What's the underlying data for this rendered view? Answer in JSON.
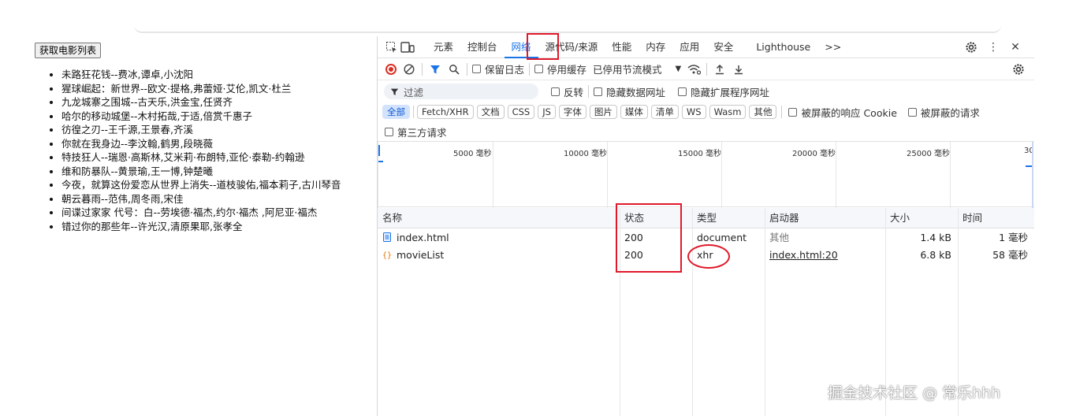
{
  "page": {
    "button_label": "获取电影列表",
    "movies": [
      "未路狂花钱--费冰,谭卓,小沈阳",
      "猩球崛起：新世界--欧文·提格,弗蕾娅·艾伦,凯文·杜兰",
      "九龙城寨之围城--古天乐,洪金宝,任贤齐",
      "哈尔的移动城堡--木村拓哉,于适,倍赏千惠子",
      "彷徨之刃--王千源,王景春,齐溪",
      "你就在我身边--李汶翰,鹤男,段晓薇",
      "特技狂人--瑞恩·高斯林,艾米莉·布朗特,亚伦·泰勒-约翰逊",
      "维和防暴队--黄景瑜,王一博,钟楚曦",
      "今夜，就算这份爱恋从世界上消失--道枝骏佑,福本莉子,古川琴音",
      "朝云暮雨--范伟,周冬雨,宋佳",
      "间谍过家家 代号：白--劳埃德·福杰,约尔·福杰 ,阿尼亚·福杰",
      "错过你的那些年--许光汉,清原果耶,张孝全"
    ]
  },
  "devtools": {
    "tabs": [
      "元素",
      "控制台",
      "网络",
      "源代码/来源",
      "性能",
      "内存",
      "应用",
      "安全",
      "Lighthouse"
    ],
    "more_tabs": ">>",
    "toolbar1": {
      "preserve_log": "保留日志",
      "disable_cache": "停用缓存",
      "throttle": "已停用节流模式"
    },
    "toolbar2": {
      "filter_placeholder": "过滤",
      "invert": "反转",
      "hide_data_urls": "隐藏数据网址",
      "hide_extension_urls": "隐藏扩展程序网址"
    },
    "type_filters": [
      "全部",
      "Fetch/XHR",
      "文档",
      "CSS",
      "JS",
      "字体",
      "图片",
      "媒体",
      "清单",
      "WS",
      "Wasm",
      "其他"
    ],
    "blocked_cookies": "被屏蔽的响应 Cookie",
    "blocked_requests": "被屏蔽的请求",
    "third_party": "第三方请求",
    "timeline_ticks": [
      "5000 毫秒",
      "10000 毫秒",
      "15000 毫秒",
      "20000 毫秒",
      "25000 毫秒",
      "30"
    ],
    "columns": [
      "名称",
      "状态",
      "类型",
      "启动器",
      "大小",
      "时间"
    ],
    "requests": [
      {
        "name": "index.html",
        "status": "200",
        "type": "document",
        "initiator": "其他",
        "size": "1.4 kB",
        "time": "1 毫秒"
      },
      {
        "name": "movieList",
        "status": "200",
        "type": "xhr",
        "initiator": "index.html:20",
        "size": "6.8 kB",
        "time": "58 毫秒"
      }
    ]
  },
  "watermark": "掘金技术社区 @ 常乐hhh",
  "colors": {
    "accent": "#1a73e8",
    "highlight": "#e0192a",
    "record": "#d93025"
  }
}
